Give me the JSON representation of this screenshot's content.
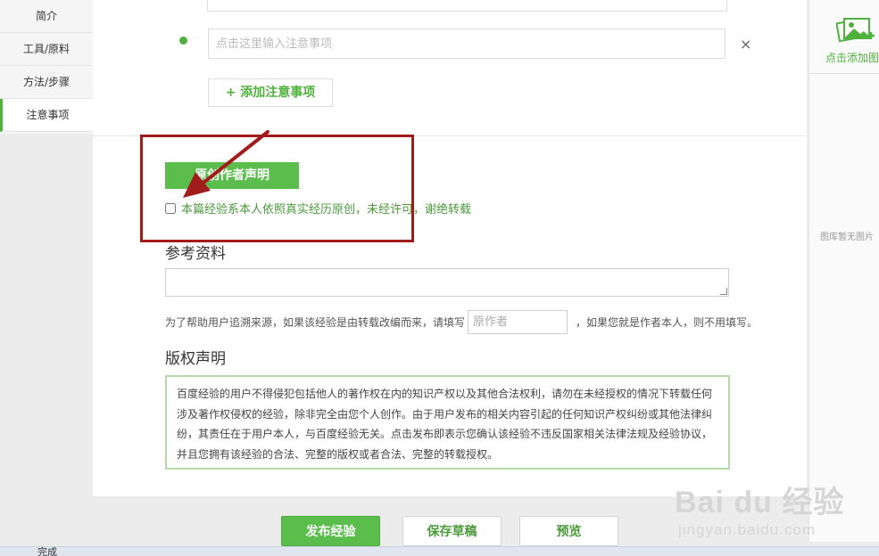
{
  "leftnav": {
    "items": [
      {
        "label": "简介"
      },
      {
        "label": "工具/原料"
      },
      {
        "label": "方法/步骤"
      },
      {
        "label": "注意事项"
      }
    ]
  },
  "notes": {
    "placeholder": "点击这里输入注意事项",
    "close_symbol": "×",
    "add_label": "+ 添加注意事项"
  },
  "original": {
    "button_label": "原创作者声明",
    "checkbox_label": "本篇经验系本人依照真实经历原创，未经许可，谢绝转载",
    "checked": false
  },
  "references": {
    "title": "参考资料",
    "help_before": "为了帮助用户追溯来源，如果该经验是由转载改编而来，请填写",
    "author_placeholder": "原作者",
    "help_after": "，如果您就是作者本人，则不用填写。"
  },
  "copyright": {
    "title": "版权声明",
    "text": "百度经验的用户不得侵犯包括他人的著作权在内的知识产权以及其他合法权利，请勿在未经授权的情况下转载任何涉及著作权侵权的经验，除非完全由您个人创作。由于用户发布的相关内容引起的任何知识产权纠纷或其他法律纠纷，其责任在于用户本人，与百度经验无关。点击发布即表示您确认该经验不违反国家相关法律法规及经验协议，并且您拥有该经验的合法、完整的版权或者合法、完整的转载授权。"
  },
  "rightpanel": {
    "add_label": "点击添加图片",
    "empty_label": "图库暂无图片"
  },
  "actions": {
    "publish": "发布经验",
    "draft": "保存草稿",
    "preview": "预览"
  },
  "watermark": {
    "brand": "Bai du 经验",
    "url": "jingyan.baidu.com"
  },
  "statusbar": {
    "text": "完成"
  },
  "colors": {
    "accent": "#5bbd4c",
    "highlight": "#a31c1c"
  }
}
